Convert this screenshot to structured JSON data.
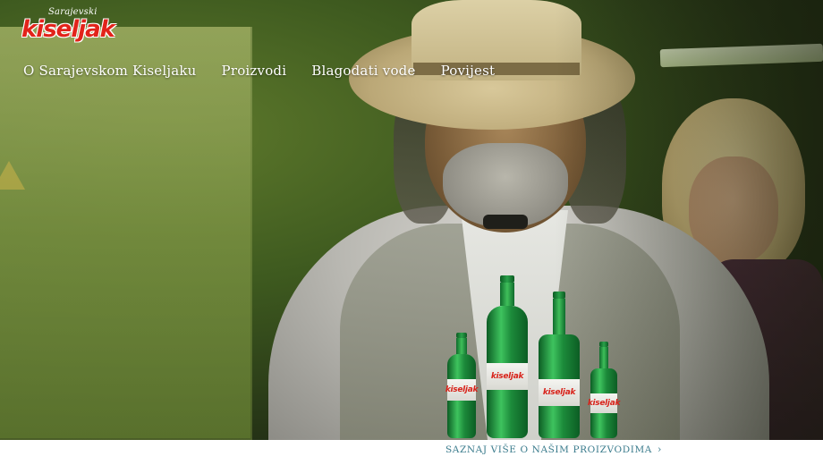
{
  "brand": {
    "logo_script": "Sarajevski",
    "logo_main": "kiseljak",
    "logo_color": "#e2231a"
  },
  "nav": {
    "items": [
      {
        "label": "O Sarajevskom Kiseljaku"
      },
      {
        "label": "Proizvodi"
      },
      {
        "label": "Blagodati vode"
      },
      {
        "label": "Povijest"
      }
    ]
  },
  "products": {
    "bottle_label": "kiseljak",
    "more_link": "Saznaj više o našim proizvodima",
    "more_link_icon": "chevron-right-icon",
    "link_color": "#3a7b8c",
    "bottle_color": "#1c8a3a"
  }
}
